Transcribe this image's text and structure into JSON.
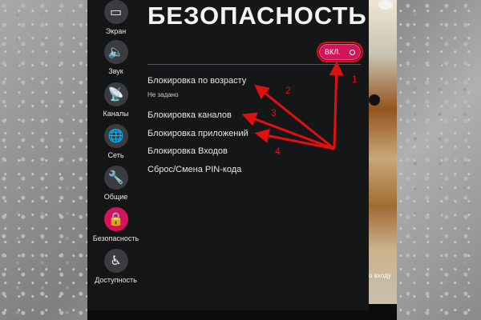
{
  "page": {
    "title": "БЕЗОПАСНОСТЬ",
    "toggle_label": "ВКЛ.",
    "side_text": "о входу"
  },
  "sidebar": {
    "items": [
      {
        "label": "Экран",
        "icon": "screen-icon"
      },
      {
        "label": "Звук",
        "icon": "speaker-icon"
      },
      {
        "label": "Каналы",
        "icon": "satellite-dish-icon"
      },
      {
        "label": "Сеть",
        "icon": "globe-icon"
      },
      {
        "label": "Общие",
        "icon": "wrench-icon"
      },
      {
        "label": "Безопасность",
        "icon": "lock-icon",
        "active": true
      },
      {
        "label": "Доступность",
        "icon": "accessibility-icon"
      }
    ]
  },
  "menu": {
    "items": [
      {
        "label": "Блокировка по возрасту",
        "sub": "Не задано"
      },
      {
        "label": "Блокировка каналов"
      },
      {
        "label": "Блокировка приложений"
      },
      {
        "label": "Блокировка Входов"
      },
      {
        "label": "Сброс/Смена PIN-кода"
      }
    ]
  },
  "annotations": {
    "numbers": [
      "1",
      "2",
      "3",
      "4"
    ],
    "color": "#e01010"
  },
  "colors": {
    "accent": "#d4145a",
    "panel": "#151618",
    "text": "#e6e6e6"
  }
}
